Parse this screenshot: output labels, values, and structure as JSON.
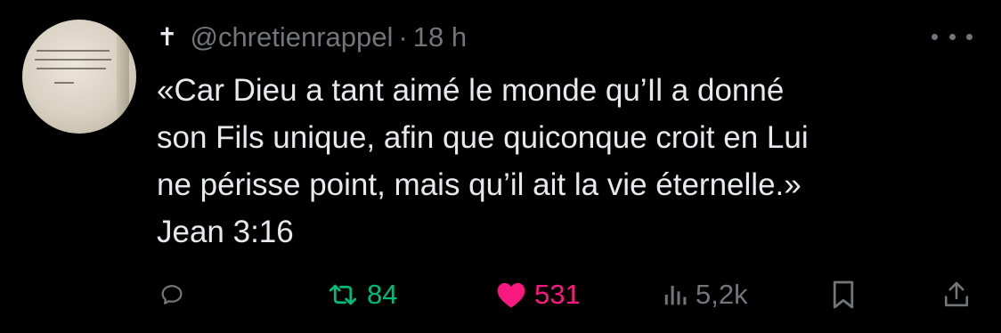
{
  "tweet": {
    "author_badge": "✝",
    "handle": "@chretienrappel",
    "separator": "·",
    "time": "18 h",
    "text_lines": [
      "«Car Dieu a tant aimé le monde qu’Il a donné",
      "son Fils unique, afin que quiconque croit en Lui",
      "ne périsse point, mais qu’il ait la vie éternelle.»",
      "Jean 3:16"
    ]
  },
  "actions": {
    "reply": {
      "icon": "reply-icon"
    },
    "repost": {
      "icon": "repost-icon",
      "count": "84",
      "color": "#00ba7c"
    },
    "like": {
      "icon": "heart-icon",
      "count": "531",
      "color": "#f91880"
    },
    "views": {
      "icon": "views-icon",
      "count": "5,2k"
    },
    "bookmark": {
      "icon": "bookmark-icon"
    },
    "share": {
      "icon": "share-icon"
    }
  },
  "colors": {
    "background": "#000000",
    "text": "#e7e9ea",
    "secondary": "#71767b"
  }
}
